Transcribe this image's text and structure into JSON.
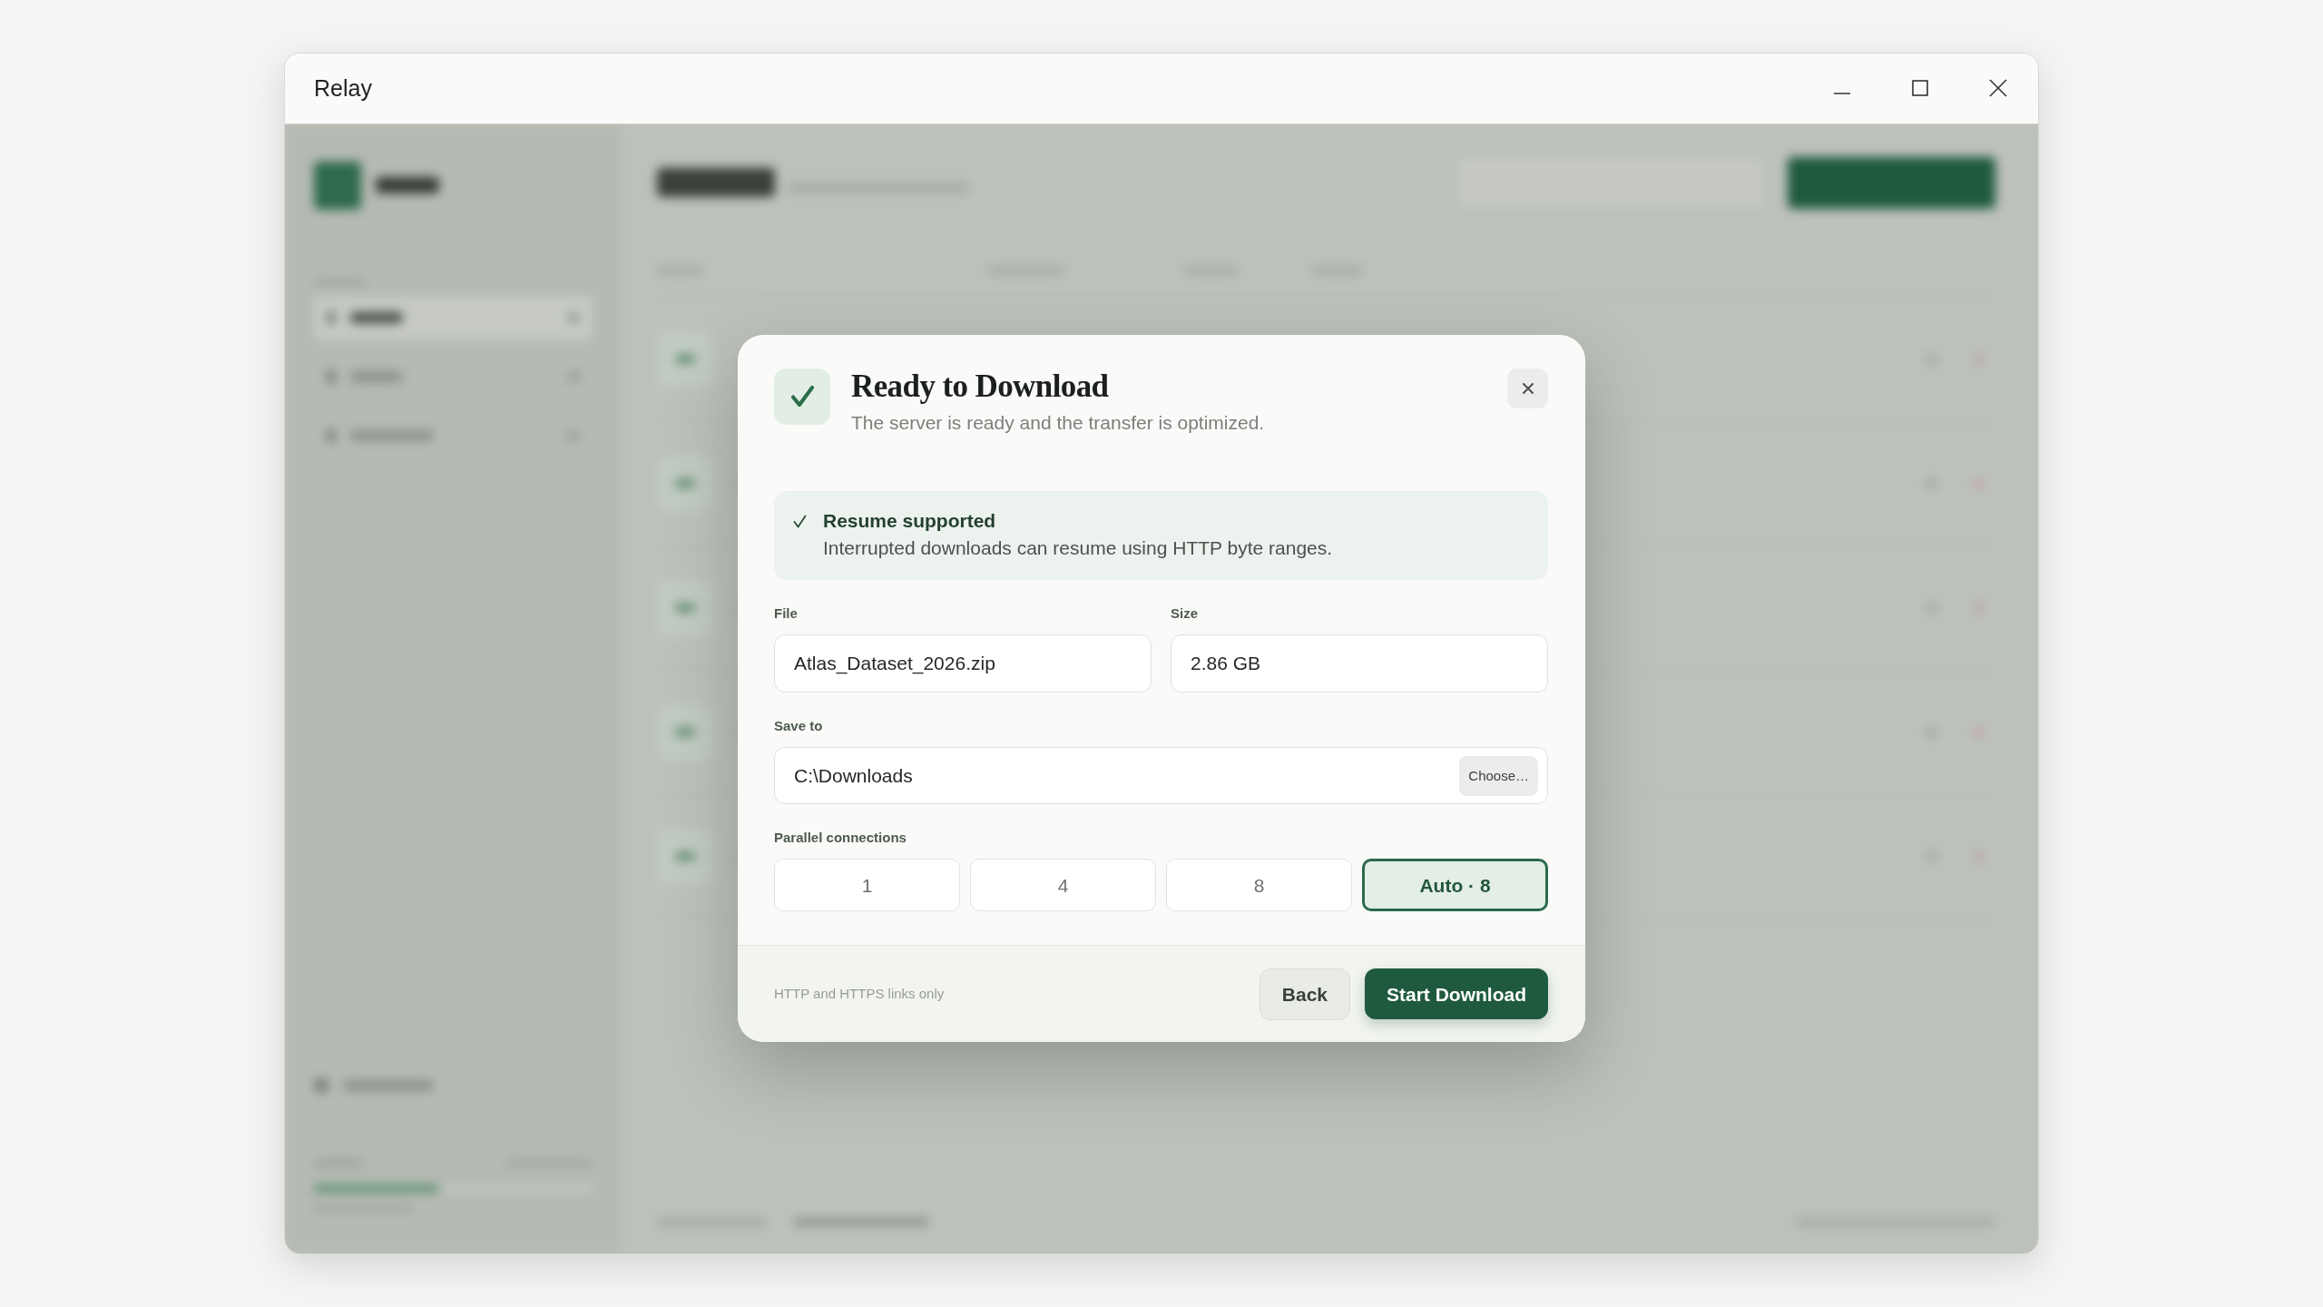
{
  "window": {
    "title": "Relay"
  },
  "dialog": {
    "title": "Ready to Download",
    "subtitle": "The server is ready and the transfer is optimized.",
    "notice": {
      "title": "Resume supported",
      "text": "Interrupted downloads can resume using HTTP byte ranges."
    },
    "fields": [
      {
        "label": "File",
        "value": "Atlas_Dataset_2026.zip"
      },
      {
        "label": "Size",
        "value": "2.86 GB"
      }
    ],
    "save_to": {
      "label": "Save to",
      "value": "C:\\Downloads",
      "button": "Choose…"
    },
    "connections": {
      "label": "Parallel connections",
      "options": [
        {
          "label": "1",
          "selected": false
        },
        {
          "label": "4",
          "selected": false
        },
        {
          "label": "8",
          "selected": false
        },
        {
          "label": "Auto · 8",
          "selected": true
        }
      ]
    },
    "footer": {
      "note": "HTTP and HTTPS links only",
      "buttons": [
        {
          "label": "Back",
          "kind": "secondary"
        },
        {
          "label": "Start Download",
          "kind": "primary"
        }
      ]
    }
  }
}
